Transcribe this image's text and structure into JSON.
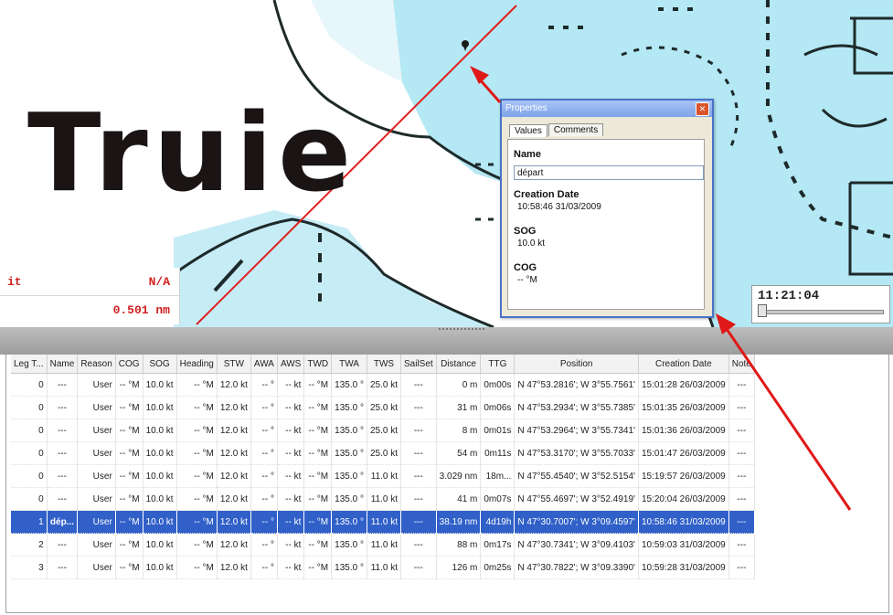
{
  "map": {
    "place_label": "Truie",
    "info_rows": [
      {
        "key": "it",
        "value": "N/A"
      },
      {
        "key": "",
        "value": "0.501 nm"
      }
    ],
    "clock": "11:21:04",
    "colors": {
      "sea": "#b4e8f4",
      "route": "#e02020",
      "coast": "#1e2a2a"
    }
  },
  "dialog": {
    "title": "Properties",
    "close_icon": "close-icon",
    "tabs": [
      "Values",
      "Comments"
    ],
    "fields": {
      "name_label": "Name",
      "name_value": "départ",
      "creation_label": "Creation Date",
      "creation_value": "10:58:46 31/03/2009",
      "sog_label": "SOG",
      "sog_value": "10.0 kt",
      "cog_label": "COG",
      "cog_value": "-- °M"
    }
  },
  "table": {
    "columns": [
      "Leg T...",
      "Name",
      "Reason",
      "COG",
      "SOG",
      "Heading",
      "STW",
      "AWA",
      "AWS",
      "TWD",
      "TWA",
      "TWS",
      "SailSet",
      "Distance",
      "TTG",
      "Position",
      "Creation Date",
      "Note"
    ],
    "rows": [
      [
        "0",
        "---",
        "User",
        "-- °M",
        "10.0 kt",
        "-- °M",
        "12.0 kt",
        "-- °",
        "-- kt",
        "-- °M",
        "135.0 °",
        "25.0 kt",
        "---",
        "0 m",
        "0m00s",
        "N 47°53.2816'; W 3°55.7561'",
        "15:01:28 26/03/2009",
        "---"
      ],
      [
        "0",
        "---",
        "User",
        "-- °M",
        "10.0 kt",
        "-- °M",
        "12.0 kt",
        "-- °",
        "-- kt",
        "-- °M",
        "135.0 °",
        "25.0 kt",
        "---",
        "31 m",
        "0m06s",
        "N 47°53.2934'; W 3°55.7385'",
        "15:01:35 26/03/2009",
        "---"
      ],
      [
        "0",
        "---",
        "User",
        "-- °M",
        "10.0 kt",
        "-- °M",
        "12.0 kt",
        "-- °",
        "-- kt",
        "-- °M",
        "135.0 °",
        "25.0 kt",
        "---",
        "8 m",
        "0m01s",
        "N 47°53.2964'; W 3°55.7341'",
        "15:01:36 26/03/2009",
        "---"
      ],
      [
        "0",
        "---",
        "User",
        "-- °M",
        "10.0 kt",
        "-- °M",
        "12.0 kt",
        "-- °",
        "-- kt",
        "-- °M",
        "135.0 °",
        "25.0 kt",
        "---",
        "54 m",
        "0m11s",
        "N 47°53.3170'; W 3°55.7033'",
        "15:01:47 26/03/2009",
        "---"
      ],
      [
        "0",
        "---",
        "User",
        "-- °M",
        "10.0 kt",
        "-- °M",
        "12.0 kt",
        "-- °",
        "-- kt",
        "-- °M",
        "135.0 °",
        "11.0 kt",
        "---",
        "3.029 nm",
        "18m...",
        "N 47°55.4540'; W 3°52.5154'",
        "15:19:57 26/03/2009",
        "---"
      ],
      [
        "0",
        "---",
        "User",
        "-- °M",
        "10.0 kt",
        "-- °M",
        "12.0 kt",
        "-- °",
        "-- kt",
        "-- °M",
        "135.0 °",
        "11.0 kt",
        "---",
        "41 m",
        "0m07s",
        "N 47°55.4697'; W 3°52.4919'",
        "15:20:04 26/03/2009",
        "---"
      ],
      [
        "1",
        "dép...",
        "User",
        "-- °M",
        "10.0 kt",
        "-- °M",
        "12.0 kt",
        "-- °",
        "-- kt",
        "-- °M",
        "135.0 °",
        "11.0 kt",
        "---",
        "38.19 nm",
        "4d19h",
        "N 47°30.7007'; W 3°09.4597'",
        "10:58:46 31/03/2009",
        "---"
      ],
      [
        "2",
        "---",
        "User",
        "-- °M",
        "10.0 kt",
        "-- °M",
        "12.0 kt",
        "-- °",
        "-- kt",
        "-- °M",
        "135.0 °",
        "11.0 kt",
        "---",
        "88 m",
        "0m17s",
        "N 47°30.7341'; W 3°09.4103'",
        "10:59:03 31/03/2009",
        "---"
      ],
      [
        "3",
        "---",
        "User",
        "-- °M",
        "10.0 kt",
        "-- °M",
        "12.0 kt",
        "-- °",
        "-- kt",
        "-- °M",
        "135.0 °",
        "11.0 kt",
        "---",
        "126 m",
        "0m25s",
        "N 47°30.7822'; W 3°09.3390'",
        "10:59:28 31/03/2009",
        "---"
      ]
    ],
    "selected_row": 6,
    "selection_color": "#3060c8"
  }
}
